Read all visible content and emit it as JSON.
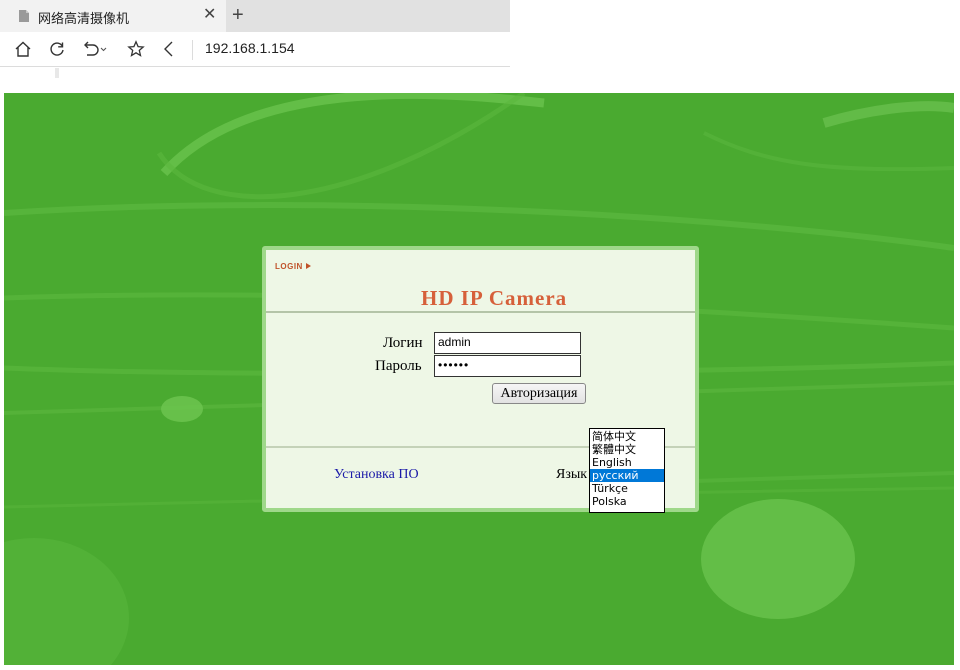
{
  "browser": {
    "tab_title": "网络高清摄像机",
    "address": "192.168.1.154"
  },
  "login_panel": {
    "login_tag": "LOGIN",
    "title": "HD IP Camera",
    "username_label": "Логин",
    "username_value": "admin",
    "password_label": "Пароль",
    "password_value": "••••••",
    "submit_label": "Авторизация",
    "install_link": "Установка ПО",
    "language_label": "Язык"
  },
  "language_options": [
    {
      "label": "简体中文",
      "selected": false
    },
    {
      "label": "繁體中文",
      "selected": false
    },
    {
      "label": "English",
      "selected": false
    },
    {
      "label": "русский",
      "selected": true
    },
    {
      "label": "Türkçe",
      "selected": false
    },
    {
      "label": "Polska",
      "selected": false
    }
  ],
  "colors": {
    "background_green": "#4aaa30",
    "title_orange": "#d6603a",
    "selection_blue": "#0078d7"
  }
}
